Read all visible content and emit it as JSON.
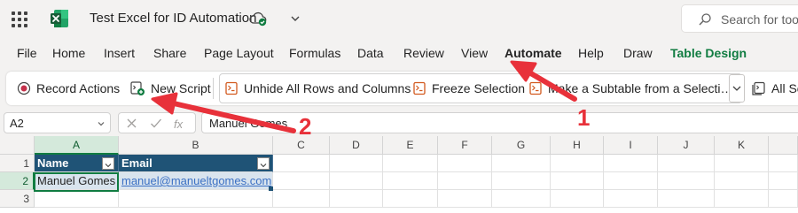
{
  "app": {
    "title": "Test Excel for ID Automation",
    "search_placeholder": "Search for tool",
    "accent_color": "#107c41"
  },
  "menu": {
    "tabs": [
      "File",
      "Home",
      "Insert",
      "Share",
      "Page Layout",
      "Formulas",
      "Data",
      "Review",
      "View",
      "Automate",
      "Help",
      "Draw",
      "Table Design"
    ],
    "active": "Automate"
  },
  "ribbon": {
    "record_actions": "Record Actions",
    "new_script": "New Script",
    "scripts": [
      "Unhide All Rows and Columns",
      "Freeze Selection",
      "Make a Subtable from a Selecti…"
    ],
    "all_scripts": "All Sc"
  },
  "formula_bar": {
    "name_box": "A2",
    "formula": "Manuel Gomes",
    "fx_label": "fx"
  },
  "grid": {
    "columns": [
      "A",
      "B",
      "C",
      "D",
      "E",
      "F",
      "G",
      "H",
      "I",
      "J",
      "K"
    ],
    "rows": [
      "1",
      "2",
      "3"
    ],
    "table_headers": [
      "Name",
      "Email"
    ],
    "table_rows": [
      [
        "Manuel Gomes",
        "manuel@manueltgomes.com"
      ]
    ]
  },
  "annotations": {
    "labels": [
      "1",
      "2"
    ],
    "color": "#e8313a"
  }
}
